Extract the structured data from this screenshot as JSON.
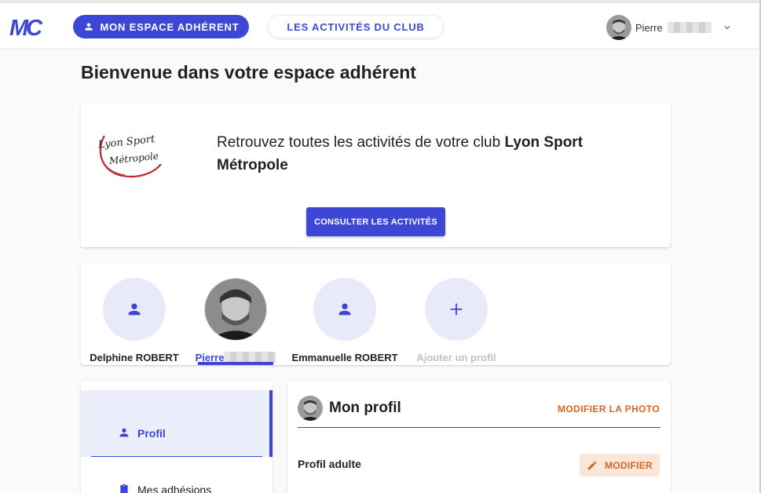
{
  "header": {
    "logo_text": "MC",
    "nav_primary": "Mon espace adhérent",
    "nav_secondary": "Les activités du club",
    "user_first_name": "Pierre"
  },
  "page": {
    "title": "Bienvenue dans votre espace adhérent"
  },
  "club": {
    "logo_text": "Lyon Sport Métropole",
    "message_prefix": "Retrouvez toutes les activités de votre club ",
    "club_name": "Lyon Sport Métropole",
    "button_label": "Consulter les activités"
  },
  "profiles": {
    "items": [
      {
        "label": "Delphine ROBERT"
      },
      {
        "label": "Pierre"
      },
      {
        "label": "Emmanuelle ROBERT"
      },
      {
        "label": "Ajouter un profil"
      }
    ]
  },
  "sidebar": {
    "items": [
      {
        "label": "Profil"
      },
      {
        "label": "Mes adhésions"
      }
    ]
  },
  "profile_card": {
    "title": "Mon profil",
    "photo_action": "Modifier la photo",
    "subtitle": "Profil adulte",
    "edit_label": "Modifier"
  },
  "colors": {
    "primary": "#3d47d6",
    "accent": "#d9661f",
    "avatar_bg": "#e8eafa"
  }
}
